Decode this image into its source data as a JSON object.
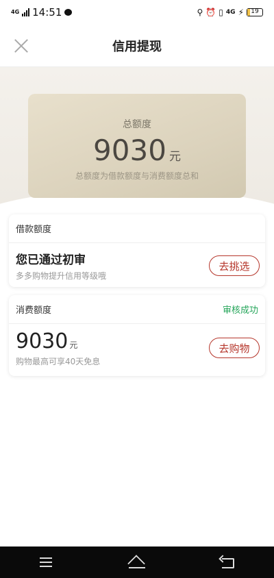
{
  "status_bar": {
    "network": "4G",
    "time": "14:51",
    "right_network": "4G",
    "battery": "19",
    "battery_level": 0.19
  },
  "header": {
    "title": "信用提现"
  },
  "banner": {
    "label": "总额度",
    "amount": "9030",
    "unit": "元",
    "note": "总额度为借款额度与消费额度总和"
  },
  "loan_section": {
    "title": "借款额度",
    "main_text": "您已通过初审",
    "sub_text": "多多购物提升信用等级哦",
    "button_label": "去挑选"
  },
  "consume_section": {
    "title": "消费额度",
    "status": "审核成功",
    "amount": "9030",
    "unit": "元",
    "sub_text": "购物最高可享40天免息",
    "button_label": "去购物"
  },
  "colors": {
    "accent": "#b5352a",
    "success": "#25a55a",
    "card_gold": "#dcd3bd"
  }
}
